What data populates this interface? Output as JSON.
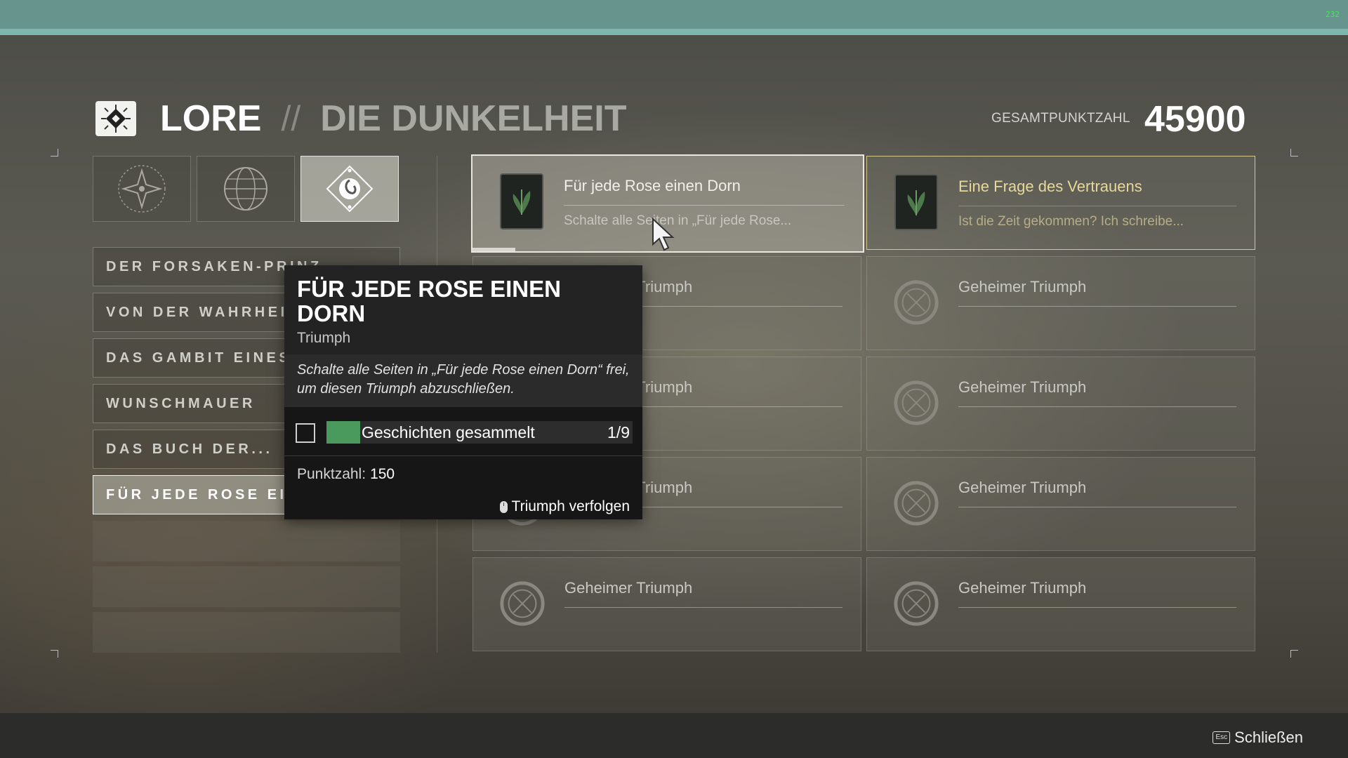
{
  "overlay": {
    "fps": "232"
  },
  "header": {
    "title": "LORE",
    "separator": "//",
    "subtitle": "DIE DUNKELHEIT",
    "score_label": "GESAMTPUNKTZAHL",
    "score_value": "45900"
  },
  "tabs": [
    {
      "icon": "star-emblem-icon",
      "active": false
    },
    {
      "icon": "globe-emblem-icon",
      "active": false
    },
    {
      "icon": "darkness-emblem-icon",
      "active": true
    }
  ],
  "menu": [
    {
      "label": "DER FORSAKEN-PRINZ"
    },
    {
      "label": "VON DER WAHRHEIT"
    },
    {
      "label": "DAS GAMBIT EINES"
    },
    {
      "label": "WUNSCHMAUER"
    },
    {
      "label": "DAS BUCH DER..."
    },
    {
      "label": "FÜR JEDE ROSE EINEN",
      "active": true
    }
  ],
  "cards": [
    {
      "title": "Für jede Rose einen Dorn",
      "desc": "Schalte alle Seiten in „Für jede Rose...",
      "state": "selected",
      "icon": "book-icon"
    },
    {
      "title": "Eine Frage des Vertrauens",
      "desc": "Ist die Zeit gekommen? Ich schreibe...",
      "state": "gold",
      "icon": "book-icon"
    },
    {
      "title": "Geheimer Triumph",
      "state": "secret",
      "icon": "secret-icon"
    },
    {
      "title": "Geheimer Triumph",
      "state": "secret",
      "icon": "secret-icon"
    },
    {
      "title": "Geheimer Triumph",
      "state": "secret",
      "icon": "secret-icon"
    },
    {
      "title": "Geheimer Triumph",
      "state": "secret",
      "icon": "secret-icon"
    },
    {
      "title": "Geheimer Triumph",
      "state": "secret",
      "icon": "secret-icon"
    },
    {
      "title": "Geheimer Triumph",
      "state": "secret",
      "icon": "secret-icon"
    },
    {
      "title": "Geheimer Triumph",
      "state": "secret",
      "icon": "secret-icon"
    },
    {
      "title": "Geheimer Triumph",
      "state": "secret",
      "icon": "secret-icon"
    }
  ],
  "selected_card_progress": 0.11,
  "tooltip": {
    "title": "FÜR JEDE ROSE EINEN DORN",
    "type": "Triumph",
    "description": "Schalte alle Seiten in „Für jede Rose einen Dorn“ frei, um diesen Triumph abzuschließen.",
    "objective_label": "Geschichten gesammelt",
    "objective_value": "1/9",
    "objective_progress": 0.111,
    "score_label": "Punktzahl:",
    "score_value": "150",
    "track_label": "Triumph verfolgen"
  },
  "footer": {
    "close_key": "Esc",
    "close_label": "Schließen"
  },
  "colors": {
    "accent_gold": "#d6c68b",
    "progress_green": "#4a9a5d",
    "topbar": "#67958e"
  }
}
